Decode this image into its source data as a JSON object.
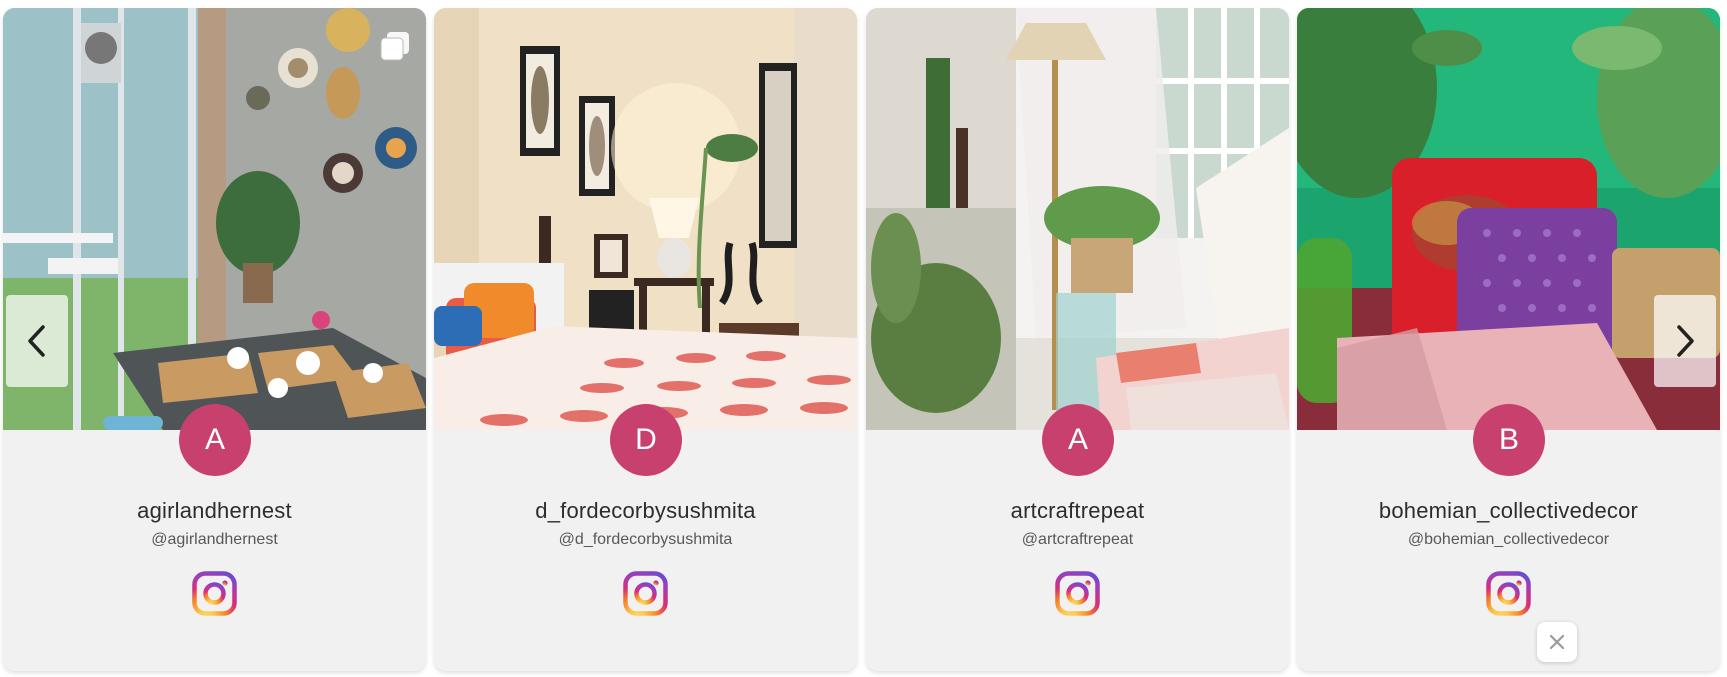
{
  "cards": [
    {
      "initial": "A",
      "name": "agirlandhernest",
      "handle": "@agirlandhernest",
      "image_alt": "Balcony tea set with wall plates and plants",
      "multi_image": true
    },
    {
      "initial": "D",
      "name": "d_fordecorbysushmita",
      "handle": "@d_fordecorbysushmita",
      "image_alt": "Bedroom with framed art, lamp and swan figurines",
      "multi_image": false
    },
    {
      "initial": "A",
      "name": "artcraftrepeat",
      "handle": "@artcraftrepeat",
      "image_alt": "Floor lamp, plants and sheer curtains by window",
      "multi_image": false
    },
    {
      "initial": "B",
      "name": "bohemian_collectivedecor",
      "handle": "@bohemian_collectivedecor",
      "image_alt": "Red elephant cushion and purple pillow on green wall",
      "multi_image": false
    }
  ],
  "icons": {
    "instagram": "instagram-icon",
    "multi_image": "multiple-images-icon",
    "prev": "chevron-left-icon",
    "next": "chevron-right-icon",
    "close": "close-icon"
  },
  "colors": {
    "avatar_bg": "#c8416e",
    "card_bg": "#f2f1f1"
  }
}
